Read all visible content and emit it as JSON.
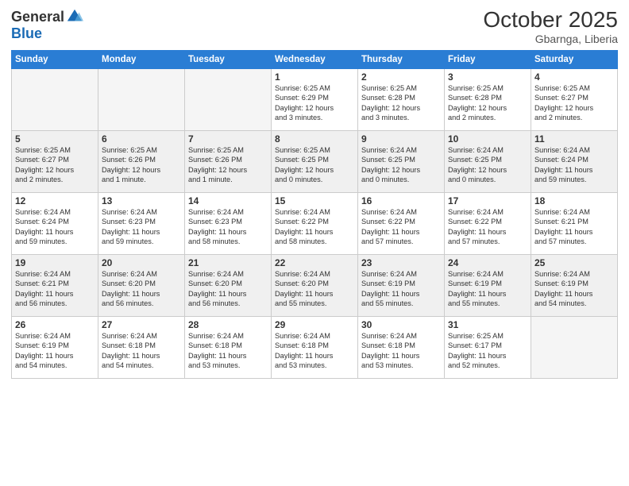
{
  "logo": {
    "general": "General",
    "blue": "Blue"
  },
  "title": {
    "month_year": "October 2025",
    "location": "Gbarnga, Liberia"
  },
  "days_of_week": [
    "Sunday",
    "Monday",
    "Tuesday",
    "Wednesday",
    "Thursday",
    "Friday",
    "Saturday"
  ],
  "weeks": [
    [
      {
        "day": "",
        "info": ""
      },
      {
        "day": "",
        "info": ""
      },
      {
        "day": "",
        "info": ""
      },
      {
        "day": "1",
        "info": "Sunrise: 6:25 AM\nSunset: 6:29 PM\nDaylight: 12 hours\nand 3 minutes."
      },
      {
        "day": "2",
        "info": "Sunrise: 6:25 AM\nSunset: 6:28 PM\nDaylight: 12 hours\nand 3 minutes."
      },
      {
        "day": "3",
        "info": "Sunrise: 6:25 AM\nSunset: 6:28 PM\nDaylight: 12 hours\nand 2 minutes."
      },
      {
        "day": "4",
        "info": "Sunrise: 6:25 AM\nSunset: 6:27 PM\nDaylight: 12 hours\nand 2 minutes."
      }
    ],
    [
      {
        "day": "5",
        "info": "Sunrise: 6:25 AM\nSunset: 6:27 PM\nDaylight: 12 hours\nand 2 minutes."
      },
      {
        "day": "6",
        "info": "Sunrise: 6:25 AM\nSunset: 6:26 PM\nDaylight: 12 hours\nand 1 minute."
      },
      {
        "day": "7",
        "info": "Sunrise: 6:25 AM\nSunset: 6:26 PM\nDaylight: 12 hours\nand 1 minute."
      },
      {
        "day": "8",
        "info": "Sunrise: 6:25 AM\nSunset: 6:25 PM\nDaylight: 12 hours\nand 0 minutes."
      },
      {
        "day": "9",
        "info": "Sunrise: 6:24 AM\nSunset: 6:25 PM\nDaylight: 12 hours\nand 0 minutes."
      },
      {
        "day": "10",
        "info": "Sunrise: 6:24 AM\nSunset: 6:25 PM\nDaylight: 12 hours\nand 0 minutes."
      },
      {
        "day": "11",
        "info": "Sunrise: 6:24 AM\nSunset: 6:24 PM\nDaylight: 11 hours\nand 59 minutes."
      }
    ],
    [
      {
        "day": "12",
        "info": "Sunrise: 6:24 AM\nSunset: 6:24 PM\nDaylight: 11 hours\nand 59 minutes."
      },
      {
        "day": "13",
        "info": "Sunrise: 6:24 AM\nSunset: 6:23 PM\nDaylight: 11 hours\nand 59 minutes."
      },
      {
        "day": "14",
        "info": "Sunrise: 6:24 AM\nSunset: 6:23 PM\nDaylight: 11 hours\nand 58 minutes."
      },
      {
        "day": "15",
        "info": "Sunrise: 6:24 AM\nSunset: 6:22 PM\nDaylight: 11 hours\nand 58 minutes."
      },
      {
        "day": "16",
        "info": "Sunrise: 6:24 AM\nSunset: 6:22 PM\nDaylight: 11 hours\nand 57 minutes."
      },
      {
        "day": "17",
        "info": "Sunrise: 6:24 AM\nSunset: 6:22 PM\nDaylight: 11 hours\nand 57 minutes."
      },
      {
        "day": "18",
        "info": "Sunrise: 6:24 AM\nSunset: 6:21 PM\nDaylight: 11 hours\nand 57 minutes."
      }
    ],
    [
      {
        "day": "19",
        "info": "Sunrise: 6:24 AM\nSunset: 6:21 PM\nDaylight: 11 hours\nand 56 minutes."
      },
      {
        "day": "20",
        "info": "Sunrise: 6:24 AM\nSunset: 6:20 PM\nDaylight: 11 hours\nand 56 minutes."
      },
      {
        "day": "21",
        "info": "Sunrise: 6:24 AM\nSunset: 6:20 PM\nDaylight: 11 hours\nand 56 minutes."
      },
      {
        "day": "22",
        "info": "Sunrise: 6:24 AM\nSunset: 6:20 PM\nDaylight: 11 hours\nand 55 minutes."
      },
      {
        "day": "23",
        "info": "Sunrise: 6:24 AM\nSunset: 6:19 PM\nDaylight: 11 hours\nand 55 minutes."
      },
      {
        "day": "24",
        "info": "Sunrise: 6:24 AM\nSunset: 6:19 PM\nDaylight: 11 hours\nand 55 minutes."
      },
      {
        "day": "25",
        "info": "Sunrise: 6:24 AM\nSunset: 6:19 PM\nDaylight: 11 hours\nand 54 minutes."
      }
    ],
    [
      {
        "day": "26",
        "info": "Sunrise: 6:24 AM\nSunset: 6:19 PM\nDaylight: 11 hours\nand 54 minutes."
      },
      {
        "day": "27",
        "info": "Sunrise: 6:24 AM\nSunset: 6:18 PM\nDaylight: 11 hours\nand 54 minutes."
      },
      {
        "day": "28",
        "info": "Sunrise: 6:24 AM\nSunset: 6:18 PM\nDaylight: 11 hours\nand 53 minutes."
      },
      {
        "day": "29",
        "info": "Sunrise: 6:24 AM\nSunset: 6:18 PM\nDaylight: 11 hours\nand 53 minutes."
      },
      {
        "day": "30",
        "info": "Sunrise: 6:24 AM\nSunset: 6:18 PM\nDaylight: 11 hours\nand 53 minutes."
      },
      {
        "day": "31",
        "info": "Sunrise: 6:25 AM\nSunset: 6:17 PM\nDaylight: 11 hours\nand 52 minutes."
      },
      {
        "day": "",
        "info": ""
      }
    ]
  ]
}
